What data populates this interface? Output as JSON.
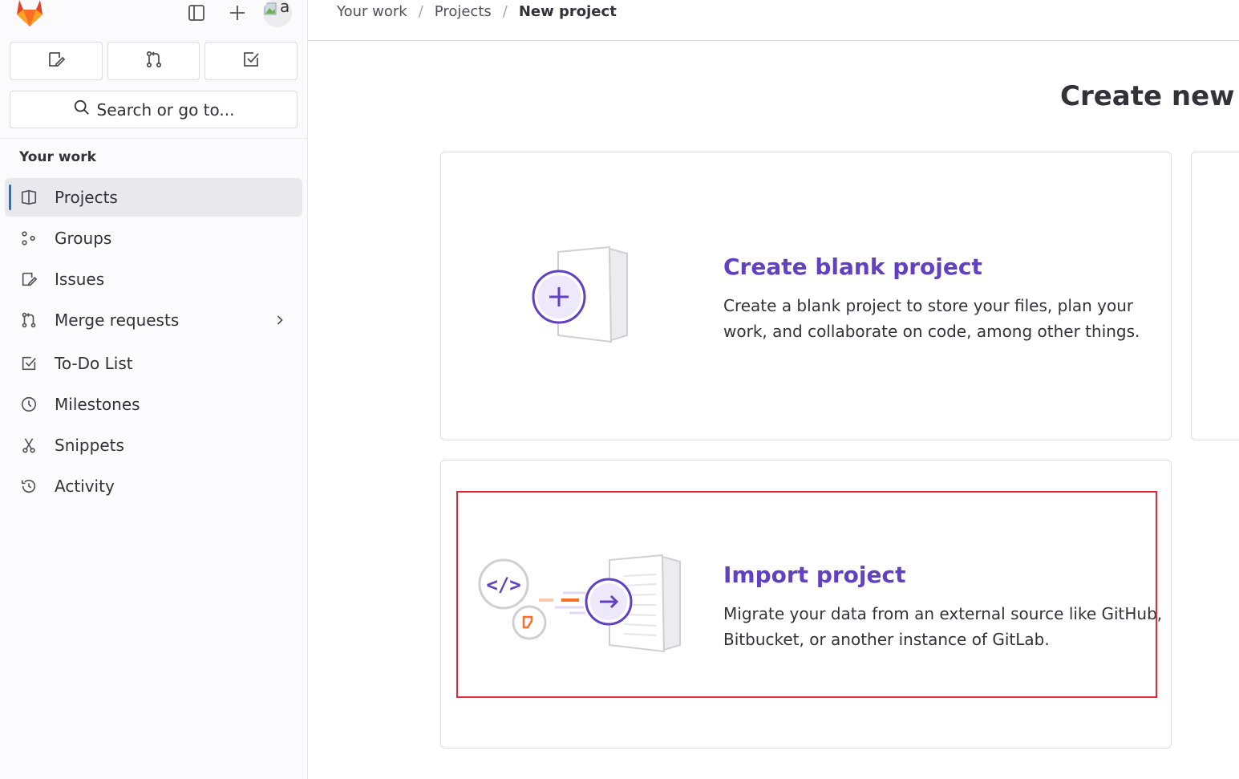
{
  "brand": {
    "accent": "#6240c2",
    "highlight": "#dd2b3a",
    "active_bar": "#1f75cb"
  },
  "topbar": {
    "logo_icon": "gitlab-tanuki-icon",
    "toggle_sidebar_icon": "sidebar-toggle-icon",
    "create_icon": "plus-icon",
    "avatar_alt": "a"
  },
  "quick_actions": [
    {
      "icon": "issues-icon"
    },
    {
      "icon": "merge-request-icon"
    },
    {
      "icon": "todo-icon"
    }
  ],
  "search": {
    "label": "Search or go to..."
  },
  "sidebar": {
    "section_title": "Your work",
    "items": [
      {
        "label": "Projects",
        "icon": "project-icon",
        "active": true
      },
      {
        "label": "Groups",
        "icon": "group-icon"
      },
      {
        "label": "Issues",
        "icon": "issues-icon"
      },
      {
        "label": "Merge requests",
        "icon": "merge-request-icon",
        "has_submenu": true
      },
      {
        "label": "To-Do List",
        "icon": "todo-icon"
      },
      {
        "label": "Milestones",
        "icon": "clock-icon"
      },
      {
        "label": "Snippets",
        "icon": "snippet-icon"
      },
      {
        "label": "Activity",
        "icon": "history-icon"
      }
    ]
  },
  "breadcrumb": {
    "items": [
      "Your work",
      "Projects"
    ],
    "current": "New project"
  },
  "main": {
    "title": "Create new pr",
    "cards": [
      {
        "title": "Create blank project",
        "description": "Create a blank project to store your files, plan your work, and collaborate on code, among other things."
      },
      {
        "title": "Import project",
        "description": "Migrate your data from an external source like GitHub, Bitbucket, or another instance of GitLab."
      }
    ]
  }
}
